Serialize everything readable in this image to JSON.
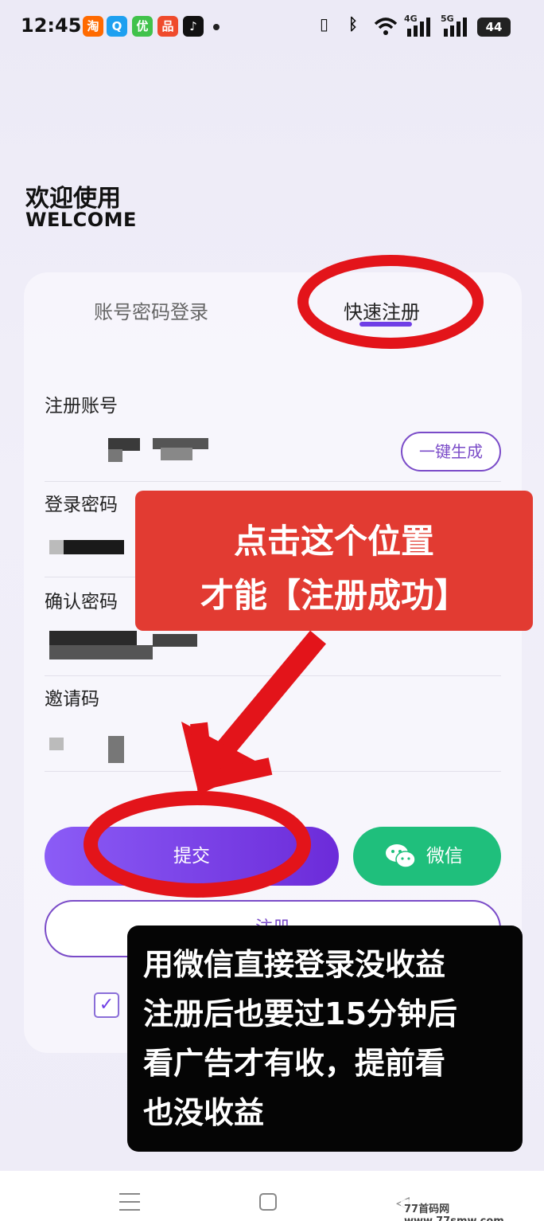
{
  "status_bar": {
    "time": "12:45",
    "apps": [
      {
        "label": "淘",
        "icon": "taobao-icon",
        "color": "#ff6a00"
      },
      {
        "label": "Q",
        "icon": "qq-icon",
        "color": "#1ea0f0"
      },
      {
        "label": "优",
        "icon": "shopping-icon",
        "color": "#41c24b"
      },
      {
        "label": "品",
        "icon": "pinduoduo-icon",
        "color": "#ef4b2c"
      },
      {
        "label": "♪",
        "icon": "tiktok-icon",
        "color": "#111111"
      }
    ],
    "network": {
      "g4": "4G",
      "g5": "5G"
    },
    "battery": "44"
  },
  "header": {
    "title": "欢迎使用",
    "subtitle": "WELCOME"
  },
  "tabs": {
    "login": "账号密码登录",
    "register": "快速注册",
    "accent": "#6f3ee6"
  },
  "form": {
    "account_label": "注册账号",
    "generate_button": "一键生成",
    "password_label": "登录密码",
    "confirm_label": "确认密码",
    "invite_label": "邀请码"
  },
  "buttons": {
    "submit": "提交",
    "wechat": "微信",
    "register": "注册",
    "checkbox": "✓"
  },
  "annotations": {
    "red_line1": "点击这个位置",
    "red_line2": "才能【注册成功】",
    "black_lines": [
      "用微信直接登录没收益",
      "注册后也要过15分钟后",
      "看广告才有收，提前看",
      "也没收益"
    ]
  },
  "nav": {
    "back": "◁"
  },
  "watermark": "77首码网 www.77smw.com"
}
